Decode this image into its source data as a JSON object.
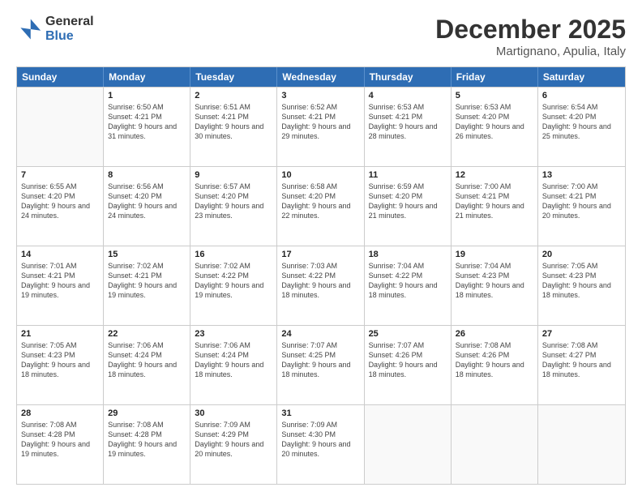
{
  "logo": {
    "general": "General",
    "blue": "Blue"
  },
  "title": {
    "month": "December 2025",
    "location": "Martignano, Apulia, Italy"
  },
  "header_days": [
    "Sunday",
    "Monday",
    "Tuesday",
    "Wednesday",
    "Thursday",
    "Friday",
    "Saturday"
  ],
  "weeks": [
    [
      {
        "day": "",
        "sunrise": "",
        "sunset": "",
        "daylight": ""
      },
      {
        "day": "1",
        "sunrise": "Sunrise: 6:50 AM",
        "sunset": "Sunset: 4:21 PM",
        "daylight": "Daylight: 9 hours and 31 minutes."
      },
      {
        "day": "2",
        "sunrise": "Sunrise: 6:51 AM",
        "sunset": "Sunset: 4:21 PM",
        "daylight": "Daylight: 9 hours and 30 minutes."
      },
      {
        "day": "3",
        "sunrise": "Sunrise: 6:52 AM",
        "sunset": "Sunset: 4:21 PM",
        "daylight": "Daylight: 9 hours and 29 minutes."
      },
      {
        "day": "4",
        "sunrise": "Sunrise: 6:53 AM",
        "sunset": "Sunset: 4:21 PM",
        "daylight": "Daylight: 9 hours and 28 minutes."
      },
      {
        "day": "5",
        "sunrise": "Sunrise: 6:53 AM",
        "sunset": "Sunset: 4:20 PM",
        "daylight": "Daylight: 9 hours and 26 minutes."
      },
      {
        "day": "6",
        "sunrise": "Sunrise: 6:54 AM",
        "sunset": "Sunset: 4:20 PM",
        "daylight": "Daylight: 9 hours and 25 minutes."
      }
    ],
    [
      {
        "day": "7",
        "sunrise": "Sunrise: 6:55 AM",
        "sunset": "Sunset: 4:20 PM",
        "daylight": "Daylight: 9 hours and 24 minutes."
      },
      {
        "day": "8",
        "sunrise": "Sunrise: 6:56 AM",
        "sunset": "Sunset: 4:20 PM",
        "daylight": "Daylight: 9 hours and 24 minutes."
      },
      {
        "day": "9",
        "sunrise": "Sunrise: 6:57 AM",
        "sunset": "Sunset: 4:20 PM",
        "daylight": "Daylight: 9 hours and 23 minutes."
      },
      {
        "day": "10",
        "sunrise": "Sunrise: 6:58 AM",
        "sunset": "Sunset: 4:20 PM",
        "daylight": "Daylight: 9 hours and 22 minutes."
      },
      {
        "day": "11",
        "sunrise": "Sunrise: 6:59 AM",
        "sunset": "Sunset: 4:20 PM",
        "daylight": "Daylight: 9 hours and 21 minutes."
      },
      {
        "day": "12",
        "sunrise": "Sunrise: 7:00 AM",
        "sunset": "Sunset: 4:21 PM",
        "daylight": "Daylight: 9 hours and 21 minutes."
      },
      {
        "day": "13",
        "sunrise": "Sunrise: 7:00 AM",
        "sunset": "Sunset: 4:21 PM",
        "daylight": "Daylight: 9 hours and 20 minutes."
      }
    ],
    [
      {
        "day": "14",
        "sunrise": "Sunrise: 7:01 AM",
        "sunset": "Sunset: 4:21 PM",
        "daylight": "Daylight: 9 hours and 19 minutes."
      },
      {
        "day": "15",
        "sunrise": "Sunrise: 7:02 AM",
        "sunset": "Sunset: 4:21 PM",
        "daylight": "Daylight: 9 hours and 19 minutes."
      },
      {
        "day": "16",
        "sunrise": "Sunrise: 7:02 AM",
        "sunset": "Sunset: 4:22 PM",
        "daylight": "Daylight: 9 hours and 19 minutes."
      },
      {
        "day": "17",
        "sunrise": "Sunrise: 7:03 AM",
        "sunset": "Sunset: 4:22 PM",
        "daylight": "Daylight: 9 hours and 18 minutes."
      },
      {
        "day": "18",
        "sunrise": "Sunrise: 7:04 AM",
        "sunset": "Sunset: 4:22 PM",
        "daylight": "Daylight: 9 hours and 18 minutes."
      },
      {
        "day": "19",
        "sunrise": "Sunrise: 7:04 AM",
        "sunset": "Sunset: 4:23 PM",
        "daylight": "Daylight: 9 hours and 18 minutes."
      },
      {
        "day": "20",
        "sunrise": "Sunrise: 7:05 AM",
        "sunset": "Sunset: 4:23 PM",
        "daylight": "Daylight: 9 hours and 18 minutes."
      }
    ],
    [
      {
        "day": "21",
        "sunrise": "Sunrise: 7:05 AM",
        "sunset": "Sunset: 4:23 PM",
        "daylight": "Daylight: 9 hours and 18 minutes."
      },
      {
        "day": "22",
        "sunrise": "Sunrise: 7:06 AM",
        "sunset": "Sunset: 4:24 PM",
        "daylight": "Daylight: 9 hours and 18 minutes."
      },
      {
        "day": "23",
        "sunrise": "Sunrise: 7:06 AM",
        "sunset": "Sunset: 4:24 PM",
        "daylight": "Daylight: 9 hours and 18 minutes."
      },
      {
        "day": "24",
        "sunrise": "Sunrise: 7:07 AM",
        "sunset": "Sunset: 4:25 PM",
        "daylight": "Daylight: 9 hours and 18 minutes."
      },
      {
        "day": "25",
        "sunrise": "Sunrise: 7:07 AM",
        "sunset": "Sunset: 4:26 PM",
        "daylight": "Daylight: 9 hours and 18 minutes."
      },
      {
        "day": "26",
        "sunrise": "Sunrise: 7:08 AM",
        "sunset": "Sunset: 4:26 PM",
        "daylight": "Daylight: 9 hours and 18 minutes."
      },
      {
        "day": "27",
        "sunrise": "Sunrise: 7:08 AM",
        "sunset": "Sunset: 4:27 PM",
        "daylight": "Daylight: 9 hours and 18 minutes."
      }
    ],
    [
      {
        "day": "28",
        "sunrise": "Sunrise: 7:08 AM",
        "sunset": "Sunset: 4:28 PM",
        "daylight": "Daylight: 9 hours and 19 minutes."
      },
      {
        "day": "29",
        "sunrise": "Sunrise: 7:08 AM",
        "sunset": "Sunset: 4:28 PM",
        "daylight": "Daylight: 9 hours and 19 minutes."
      },
      {
        "day": "30",
        "sunrise": "Sunrise: 7:09 AM",
        "sunset": "Sunset: 4:29 PM",
        "daylight": "Daylight: 9 hours and 20 minutes."
      },
      {
        "day": "31",
        "sunrise": "Sunrise: 7:09 AM",
        "sunset": "Sunset: 4:30 PM",
        "daylight": "Daylight: 9 hours and 20 minutes."
      },
      {
        "day": "",
        "sunrise": "",
        "sunset": "",
        "daylight": ""
      },
      {
        "day": "",
        "sunrise": "",
        "sunset": "",
        "daylight": ""
      },
      {
        "day": "",
        "sunrise": "",
        "sunset": "",
        "daylight": ""
      }
    ]
  ]
}
